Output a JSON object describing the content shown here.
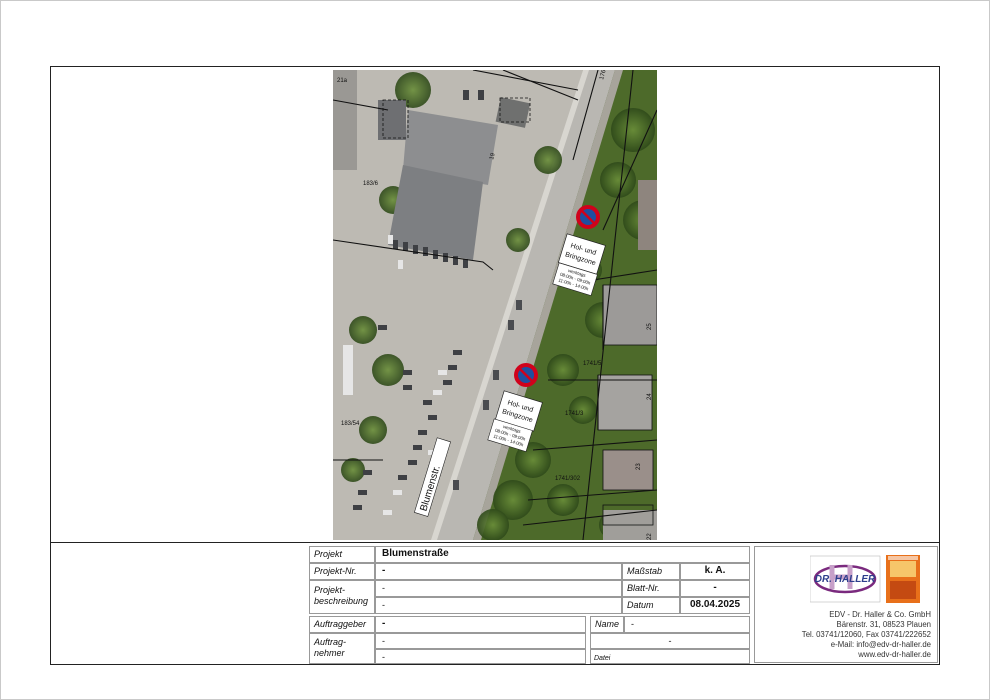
{
  "map": {
    "street_name": "Blumenstr.",
    "parcel_numbers": [
      "21a",
      "19",
      "183/6",
      "183/54",
      "1741/5",
      "1741/3",
      "1741/302",
      "176"
    ],
    "house_numbers": [
      "25",
      "24",
      "23",
      "22"
    ],
    "signs": [
      {
        "icon": "no-stopping-sign-icon",
        "zone_label": "Hol- und Bringzone",
        "time_text": "werktags 08:00h - 09:00h 11:00h - 14:00h"
      },
      {
        "icon": "no-stopping-sign-icon",
        "zone_label": "Hol- und Bringzone",
        "time_text": "werktags 08:00h - 09:00h 11:00h - 14:00h"
      }
    ]
  },
  "title_block": {
    "projekt_label": "Projekt",
    "projekt_value": "Blumenstraße",
    "projekt_nr_label": "Projekt-Nr.",
    "projekt_nr_value": "-",
    "beschreibung_label": "Projekt-beschreibung",
    "beschreibung_line1": "-",
    "beschreibung_line2": "-",
    "massstab_label": "Maßstab",
    "massstab_value": "k. A.",
    "blatt_label": "Blatt-Nr.",
    "blatt_value": "-",
    "datum_label": "Datum",
    "datum_value": "08.04.2025",
    "auftraggeber_label": "Auftraggeber",
    "auftraggeber_value": "-",
    "auftragnehmer_label": "Auftrag-nehmer",
    "auftragnehmer_line1": "-",
    "auftragnehmer_line2": "-",
    "name_label": "Name",
    "name_value": "-",
    "name_line2": "-",
    "datei_label": "Datei"
  },
  "company": {
    "logo_text": "DR. HALLER",
    "name": "EDV - Dr. Haller & Co. GmbH",
    "address": "Bärenstr. 31, 08523 Plauen",
    "phone": "Tel. 03741/12060, Fax 03741/222652",
    "email": "e-Mail: info@edv-dr-haller.de",
    "web": "www.edv-dr-haller.de"
  },
  "colors": {
    "sign_red": "#d0021b",
    "sign_blue": "#1f4fa0",
    "logo_purple": "#7a2a7e",
    "logo_orange": "#e8701a"
  }
}
